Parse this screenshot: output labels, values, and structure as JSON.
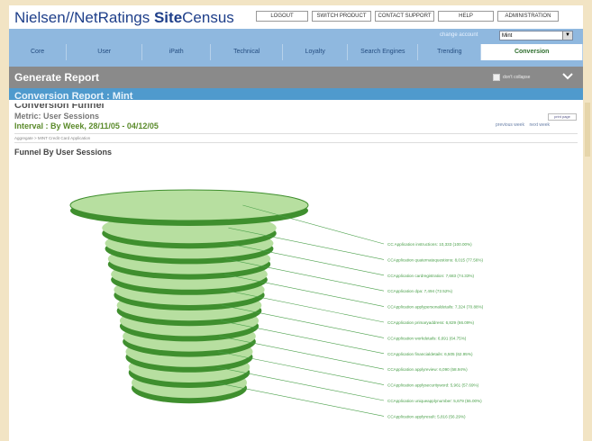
{
  "brand": {
    "part1": "Nielsen//NetRatings ",
    "part2": "Site",
    "part3": "Census"
  },
  "topnav": [
    "LOGOUT",
    "SWITCH PRODUCT",
    "CONTACT SUPPORT",
    "HELP",
    "ADMINISTRATION"
  ],
  "account": {
    "label": "change account",
    "value": "Mint"
  },
  "tabs": [
    {
      "label": "Core",
      "active": false
    },
    {
      "label": "User",
      "active": false
    },
    {
      "label": "iPath",
      "active": false
    },
    {
      "label": "Technical",
      "active": false
    },
    {
      "label": "Loyalty",
      "active": false
    },
    {
      "label": "Search Engines",
      "active": false
    },
    {
      "label": "Trending",
      "active": false
    },
    {
      "label": "Conversion",
      "active": true
    }
  ],
  "section": {
    "title": "Generate Report",
    "collapse_label": "don't collapse"
  },
  "report_header": "Conversion Report : Mint",
  "report": {
    "funnel_heading": "Conversion Funnel",
    "metric": "Metric: User Sessions",
    "interval": "Interval :  By Week,  28/11/05 - 04/12/05",
    "print_label": "print page",
    "prev_week": "previous week",
    "next_week": "next week",
    "breadcrumb": "Aggregate > MINT Credit Card Application",
    "funnel_title": "Funnel By User Sessions"
  },
  "colors": {
    "funnel_green": "#3f8f2e",
    "funnel_light": "#b7dfa0",
    "label_green": "#4aa04a"
  },
  "funnel_steps": [
    {
      "label": "CC Application instructions: 10,333 (100.00%)",
      "value": 10333,
      "percent": 100.0
    },
    {
      "label": "CCApplication quaternatequestions: 8,015 (77.56%)",
      "value": 8015,
      "percent": 77.56
    },
    {
      "label": "CCApplication cardregistration: 7,683 (74.33%)",
      "value": 7683,
      "percent": 74.33
    },
    {
      "label": "CCApplication dpa: 7,494 (72.52%)",
      "value": 7494,
      "percent": 72.52
    },
    {
      "label": "CCApplication applypersonaldetails: 7,324 (70.88%)",
      "value": 7324,
      "percent": 70.88
    },
    {
      "label": "CCApplication primaryaddress: 6,829 (66.09%)",
      "value": 6829,
      "percent": 66.09
    },
    {
      "label": "CCApplication workdetails: 6,691 (64.75%)",
      "value": 6691,
      "percent": 64.75
    },
    {
      "label": "CCApplication financialdetails: 6,505 (62.95%)",
      "value": 6505,
      "percent": 62.95
    },
    {
      "label": "CCApplication applyreview: 6,090 (58.94%)",
      "value": 6090,
      "percent": 58.94
    },
    {
      "label": "CCApplication applysecurityword: 5,961 (57.69%)",
      "value": 5961,
      "percent": 57.69
    },
    {
      "label": "CCApplication uniqueapplynumber: 5,679 (55.00%)",
      "value": 5679,
      "percent": 55.0
    },
    {
      "label": "CCApplication applyresult: 5,816 (56.29%)",
      "value": 5816,
      "percent": 56.29
    }
  ]
}
